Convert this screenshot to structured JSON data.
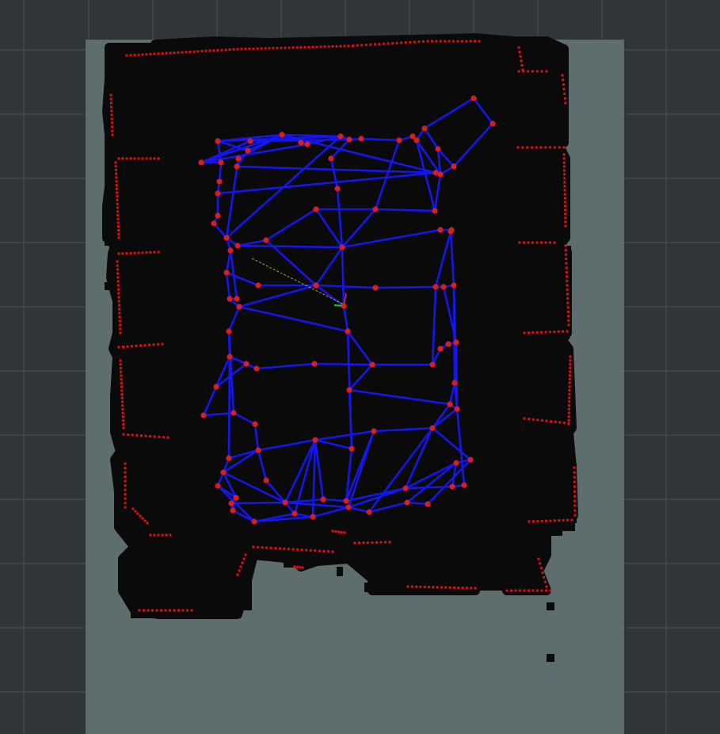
{
  "viewer": {
    "colors": {
      "background": "#2f3539",
      "grid_lines": "#4a5257",
      "unknown_area": "#5e6e6e",
      "free_space": "#c4c4c4",
      "occupied_cells": "#0a0a0a",
      "laser_points": "#dd1111",
      "roadmap_edges": "#1515ee",
      "roadmap_nodes": "#d81e1e",
      "path_line": "#cccc55",
      "axis_x": "#ee2222",
      "axis_y": "#22cc22"
    },
    "layers": [
      "grid",
      "occupancy-map",
      "laser-scan",
      "probabilistic-roadmap",
      "robot-pose"
    ]
  }
}
